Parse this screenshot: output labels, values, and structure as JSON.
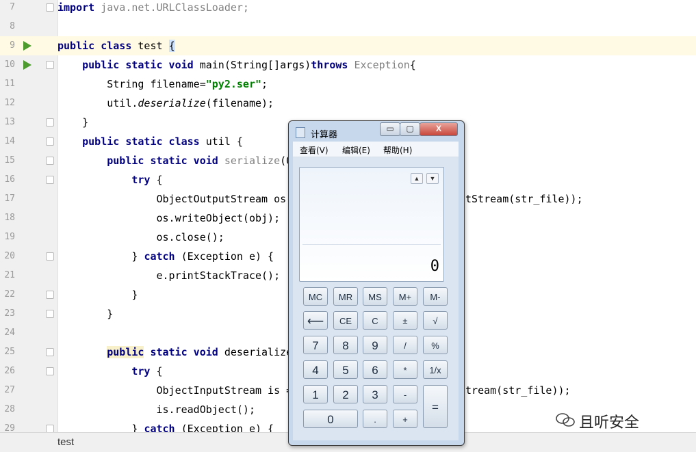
{
  "editor": {
    "status_tab": "test",
    "lines": [
      {
        "num": "7",
        "html": "<span class=\"kw\">import</span> <span class=\"gray\">java.net.URLClassLoader;</span>"
      },
      {
        "num": "8",
        "html": ""
      },
      {
        "num": "9",
        "html": "<span class=\"kw\">public class</span> test <span class=\"cursor\">{</span>"
      },
      {
        "num": "10",
        "html": "    <span class=\"kw\">public static void</span> main(String[]args)<span class=\"kw\">throws</span> <span class=\"gray\">Exception</span>{"
      },
      {
        "num": "11",
        "html": "        String filename=<span class=\"str\">\"py2.ser\"</span>;"
      },
      {
        "num": "12",
        "html": "        util.<span class=\"it\">deserialize</span>(filename);"
      },
      {
        "num": "13",
        "html": "    }"
      },
      {
        "num": "14",
        "html": "    <span class=\"kw\">public static class</span> util {"
      },
      {
        "num": "15",
        "html": "        <span class=\"kw\">public static void</span> <span class=\"gray\">serialize</span>(O"
      },
      {
        "num": "16",
        "html": "            <span class=\"kw\">try</span> {"
      },
      {
        "num": "17",
        "html": "                ObjectOutputStream os                    FileOutputStream(str_file));"
      },
      {
        "num": "18",
        "html": "                os.writeObject(obj);"
      },
      {
        "num": "19",
        "html": "                os.close();"
      },
      {
        "num": "20",
        "html": "            } <span class=\"kw\">catch</span> (Exception e) {"
      },
      {
        "num": "21",
        "html": "                e.printStackTrace();"
      },
      {
        "num": "22",
        "html": "            }"
      },
      {
        "num": "23",
        "html": "        }"
      },
      {
        "num": "24",
        "html": ""
      },
      {
        "num": "25",
        "html": "        <span class=\"kw kwhl\">public</span> <span class=\"kw\">static void</span> deserialize"
      },
      {
        "num": "26",
        "html": "            <span class=\"kw\">try</span> {"
      },
      {
        "num": "27",
        "html": "                ObjectInputStream is =                   ileInputStream(str_file));"
      },
      {
        "num": "28",
        "html": "                is.readObject();"
      },
      {
        "num": "29",
        "html": "            } <span class=\"kw\">catch</span> (Exception e) {"
      }
    ]
  },
  "calculator": {
    "title": "计算器",
    "min_label": "▭",
    "max_label": "▢",
    "close_label": "X",
    "menu": [
      "查看(V)",
      "编辑(E)",
      "帮助(H)"
    ],
    "display_value": "0",
    "up_arrow": "▲",
    "down_arrow": "▼",
    "keys": [
      "MC",
      "MR",
      "MS",
      "M+",
      "M-",
      "⟵",
      "CE",
      "C",
      "±",
      "√",
      "7",
      "8",
      "9",
      "/",
      "%",
      "4",
      "5",
      "6",
      "*",
      "1/x",
      "1",
      "2",
      "3",
      "-",
      "=",
      "0",
      ".",
      "+"
    ]
  },
  "watermark": {
    "text": "且听安全"
  }
}
